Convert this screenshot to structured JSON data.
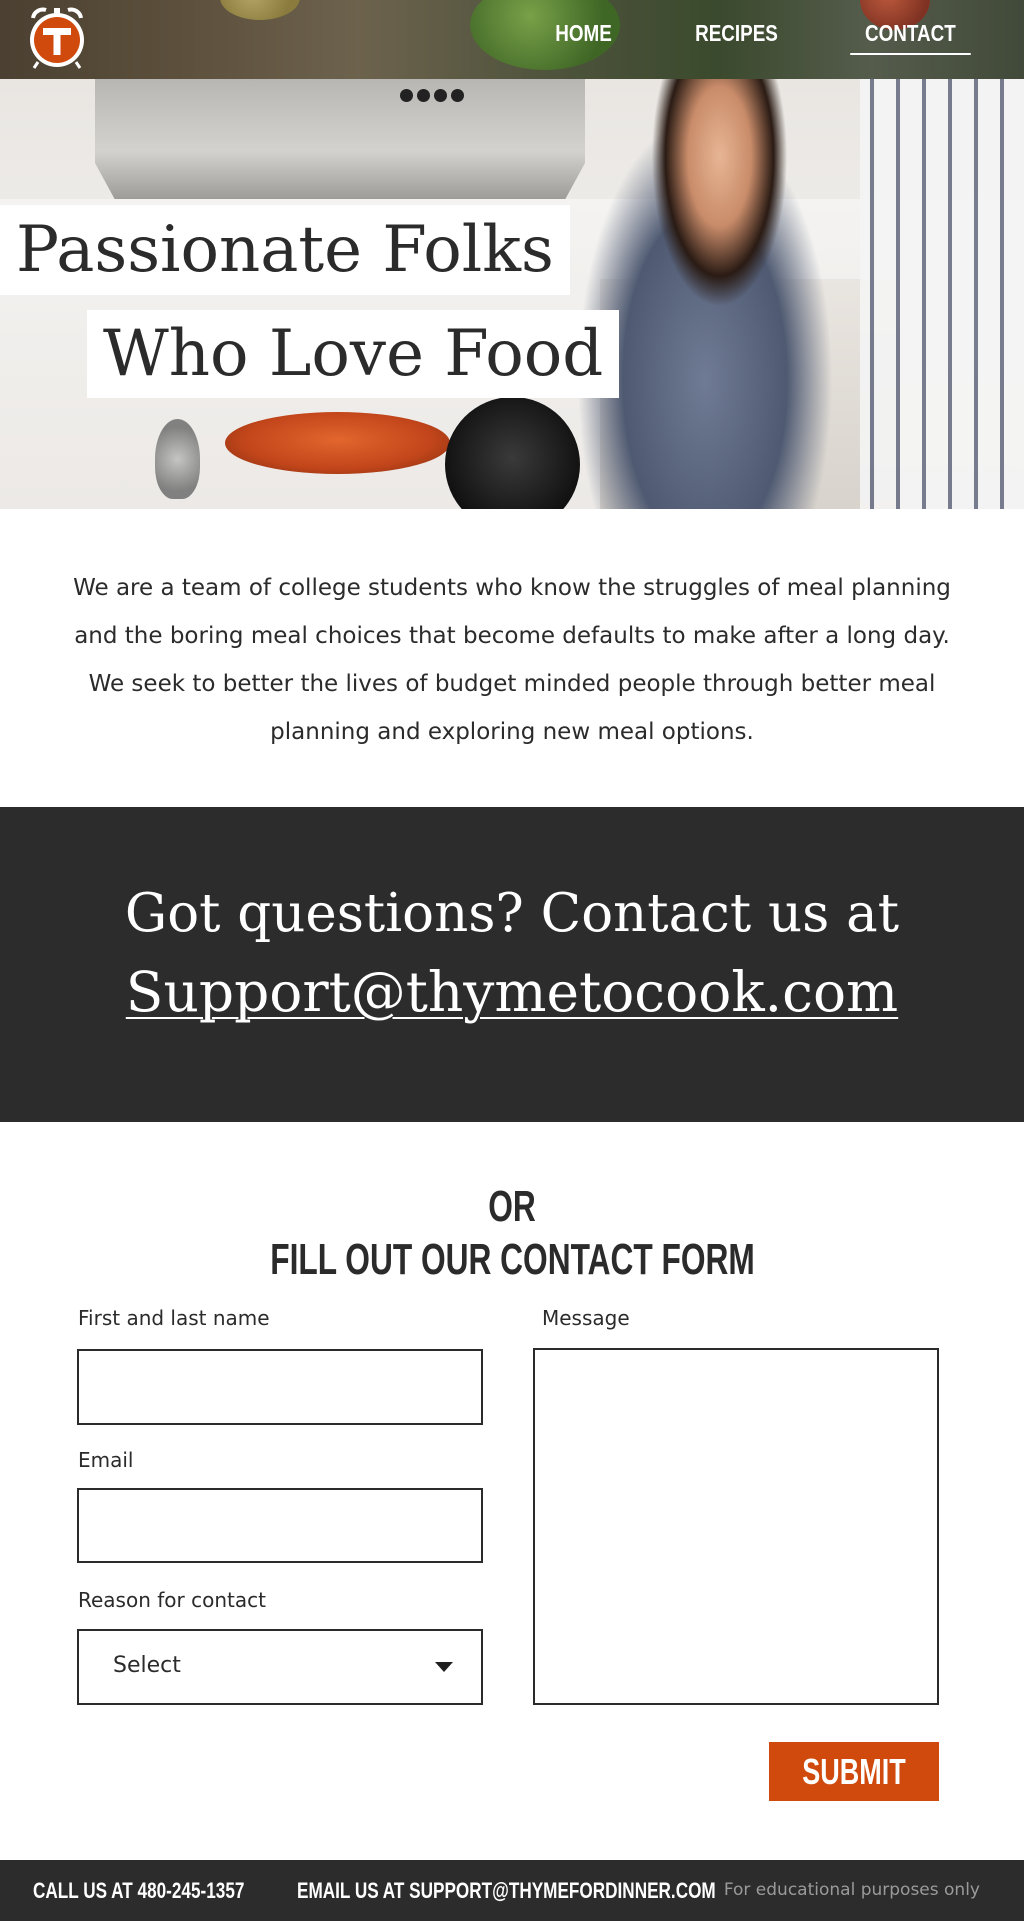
{
  "nav": {
    "logo_icon": "thyme-clock-logo-icon",
    "links": [
      {
        "label": "HOME",
        "active": false
      },
      {
        "label": "RECIPES",
        "active": false
      },
      {
        "label": "CONTACT",
        "active": true
      }
    ]
  },
  "hero": {
    "title_line1": "Passionate Folks",
    "title_line2": "Who Love Food"
  },
  "intro": {
    "text": "We are a team of college students who know the struggles of meal planning and the boring meal choices that become defaults to make after a long day. We seek to better the lives of budget minded people through better meal planning and exploring new meal options."
  },
  "contact_band": {
    "line1": "Got questions? Contact us at",
    "email_link": "Support@thymetocook.com"
  },
  "form": {
    "heading_or": "OR",
    "heading_main": "FILL OUT OUR CONTACT FORM",
    "name_label": "First and last name",
    "name_value": "",
    "email_label": "Email",
    "email_value": "",
    "reason_label": "Reason for contact",
    "reason_selected": "Select",
    "message_label": "Message",
    "message_value": "",
    "submit_label": "SUBMIT"
  },
  "footer": {
    "phone": "CALL US AT 480-245-1357",
    "email": "EMAIL US AT SUPPORT@THYMEFORDINNER.COM",
    "note": "For educational purposes only"
  },
  "colors": {
    "accent": "#cf4a0c",
    "dark": "#2c2c2c",
    "text": "#2b2b2b"
  }
}
